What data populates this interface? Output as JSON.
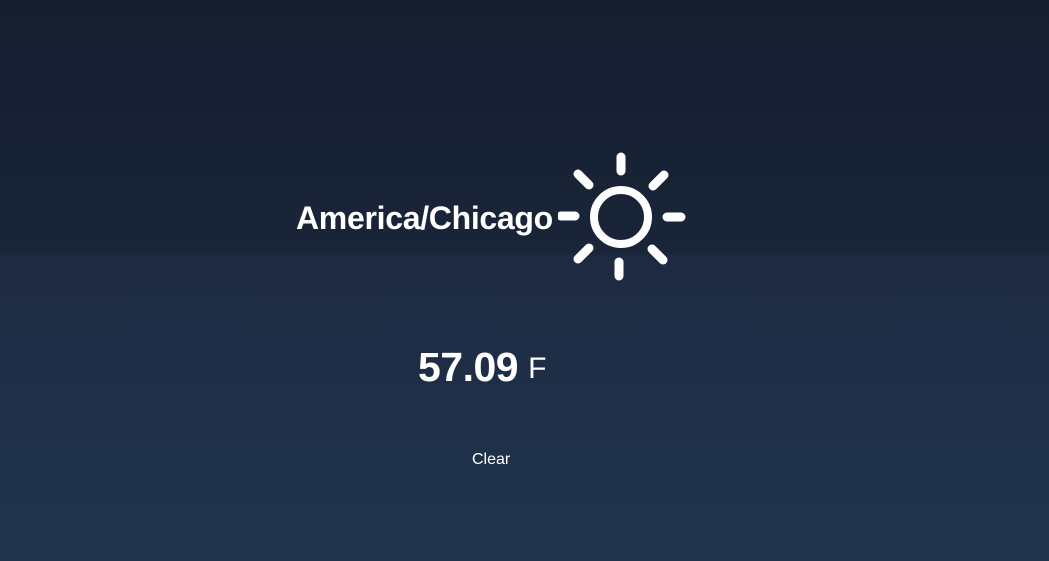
{
  "weather": {
    "location": "America/Chicago",
    "icon": "sun-icon",
    "temperature": "57.09",
    "unit": "F",
    "condition": "Clear"
  }
}
